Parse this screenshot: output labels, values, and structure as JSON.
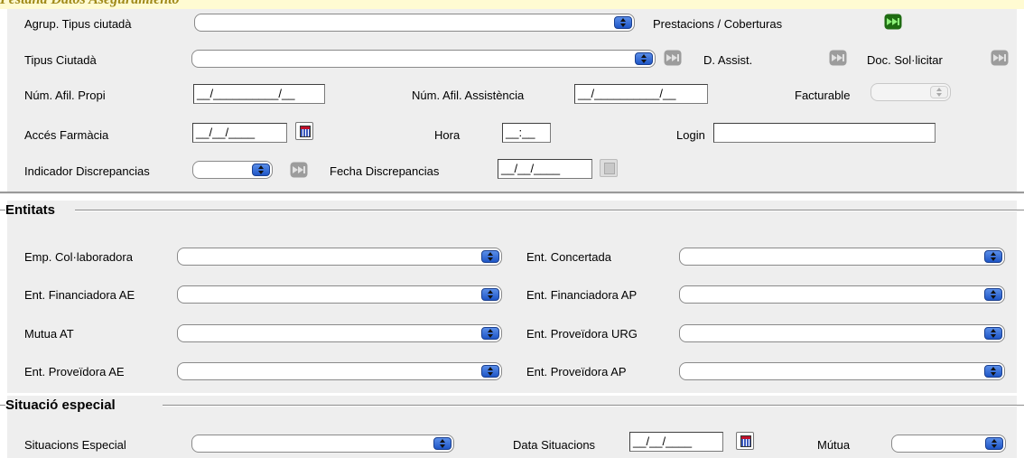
{
  "caption": "Pestaña Datos Aseguramiento",
  "top": {
    "agrup_tipus_ciutada": {
      "label": "Agrup. Tipus ciutadà",
      "value": ""
    },
    "prestacions_coberturas": {
      "label": "Prestacions / Coberturas"
    },
    "tipus_ciutada": {
      "label": "Tipus Ciutadà",
      "value": ""
    },
    "d_assist": {
      "label": "D. Assist."
    },
    "doc_sollicitar": {
      "label": "Doc. Sol·licitar"
    },
    "num_afil_propi": {
      "label": "Núm. Afil. Propi",
      "value": "__/__________/__"
    },
    "num_afil_assistencia": {
      "label": "Núm. Afil. Assistència",
      "value": "__/__________/__"
    },
    "facturable": {
      "label": "Facturable",
      "value": ""
    },
    "acces_farmacia": {
      "label": "Accés Farmàcia",
      "value": "__/__/____"
    },
    "hora": {
      "label": "Hora",
      "value": "__:__"
    },
    "login": {
      "label": "Login",
      "value": ""
    },
    "indicador_discrepancias": {
      "label": "Indicador Discrepancias",
      "value": ""
    },
    "fecha_discrepancias": {
      "label": "Fecha Discrepancias",
      "value": "__/__/____"
    }
  },
  "entitats": {
    "title": "Entitats",
    "left": [
      {
        "label": "Emp. Col·laboradora",
        "value": ""
      },
      {
        "label": "Ent. Financiadora AE",
        "value": ""
      },
      {
        "label": "Mutua AT",
        "value": ""
      },
      {
        "label": "Ent. Proveïdora AE",
        "value": ""
      }
    ],
    "right": [
      {
        "label": "Ent. Concertada",
        "value": ""
      },
      {
        "label": "Ent. Financiadora AP",
        "value": ""
      },
      {
        "label": "Ent. Proveïdora URG",
        "value": ""
      },
      {
        "label": "Ent. Proveïdora AP",
        "value": ""
      }
    ]
  },
  "situacio": {
    "title": "Situació especial",
    "situacions_especial": {
      "label": "Situacions Especial",
      "value": ""
    },
    "data_situacions": {
      "label": "Data Situacions",
      "value": "__/__/____"
    },
    "mutua": {
      "label": "Mútua",
      "value": ""
    }
  },
  "icons": {
    "prestacions": "green-forward-arrows-icon",
    "nav": "gray-forward-arrows-icon",
    "calendar": "calendar-icon"
  },
  "colors": {
    "panel_bg": "#eeeeee",
    "caption_strip": "#fffbd2",
    "caption_text": "#a08a1a",
    "dropdown_button": "#2f67d8",
    "green_icon": "#2e9a1e"
  }
}
